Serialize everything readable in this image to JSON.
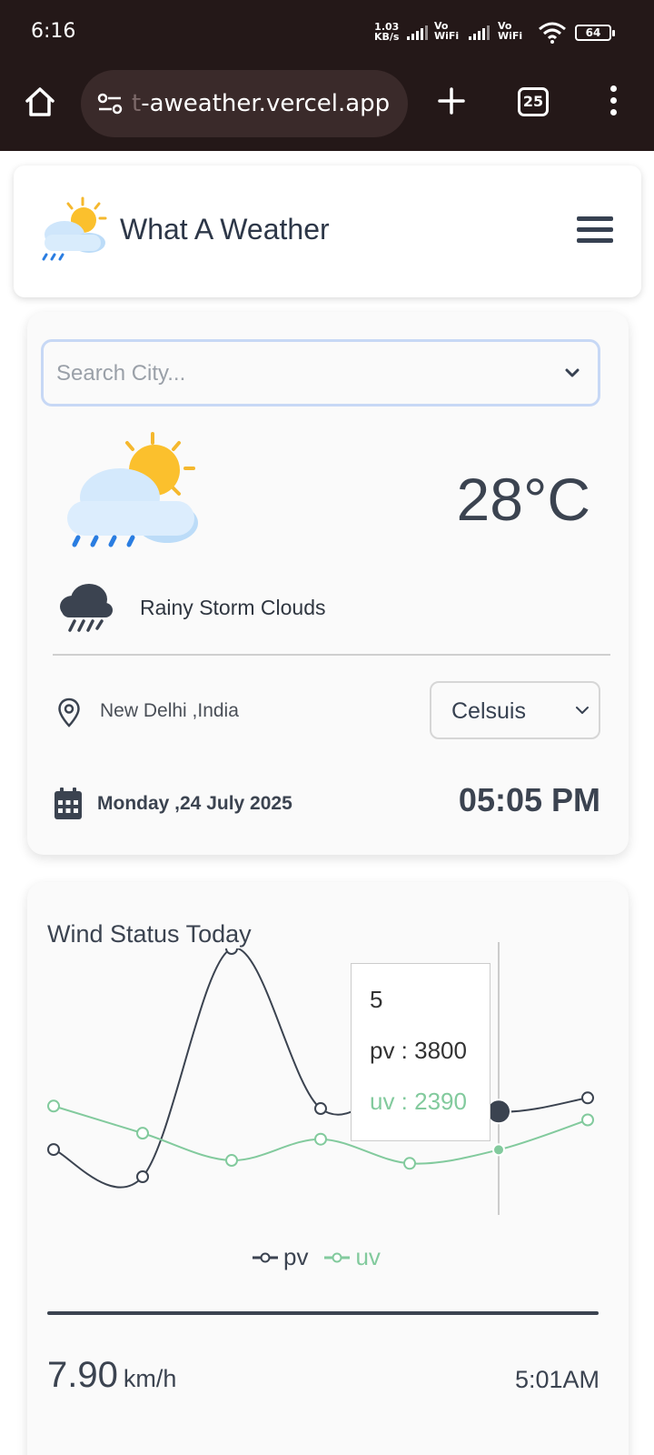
{
  "status_bar": {
    "time": "6:16",
    "net_speed_value": "1.03",
    "net_speed_unit": "KB/s",
    "vowifi_1_top": "Vo",
    "vowifi_1_bottom": "WiFi",
    "vowifi_2_top": "Vo",
    "vowifi_2_bottom": "WiFi",
    "battery": "64"
  },
  "browser": {
    "url_fade": "t",
    "url": "-aweather.vercel.app",
    "tab_count": "25"
  },
  "header": {
    "title": "What A Weather"
  },
  "weather": {
    "search_placeholder": "Search City...",
    "temperature": "28°C",
    "condition": "Rainy Storm Clouds",
    "location": "New Delhi ,India",
    "unit": "Celsuis",
    "date": "Monday ,24 July 2025",
    "time": "05:05 PM"
  },
  "wind": {
    "title": "Wind Status Today",
    "speed_value": "7.90",
    "speed_unit": "km/h",
    "sunrise_time": "5:01AM"
  },
  "tooltip": {
    "label": "5",
    "pv_text": "pv : 3800",
    "uv_text": "uv : 2390"
  },
  "chart_data": {
    "type": "line",
    "x": [
      0,
      1,
      2,
      3,
      4,
      5,
      6
    ],
    "series": [
      {
        "name": "pv",
        "values": [
          2400,
          1398,
          9800,
          3908,
          4800,
          3800,
          4300
        ],
        "color": "#3b4350"
      },
      {
        "name": "uv",
        "values": [
          4000,
          3000,
          2000,
          2780,
          1890,
          2390,
          3490
        ],
        "color": "#82ca9d"
      }
    ],
    "active_index": 5,
    "legend": "bottom-center",
    "colors": {
      "pv": "#3b4350",
      "uv": "#82ca9d"
    }
  }
}
